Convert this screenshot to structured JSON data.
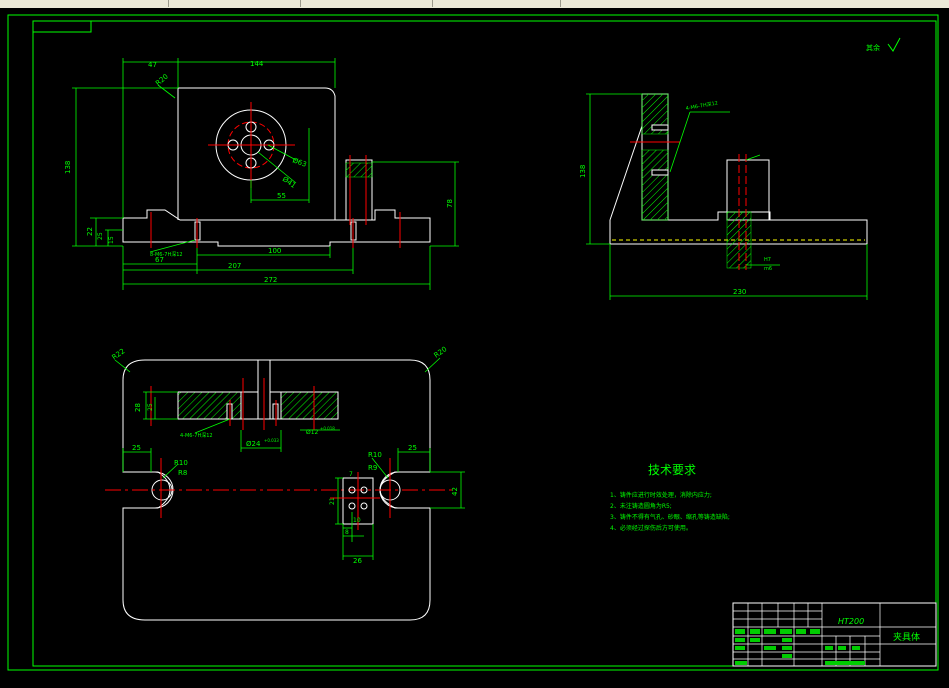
{
  "colors": {
    "background": "#000000",
    "outline": "#ffffff",
    "dimension": "#00ff00",
    "centerline": "#ff0000",
    "hatch": "#00ff00",
    "title_block_fill": "#00cc00",
    "hidden_line": "#ffff00"
  },
  "front_view": {
    "dims": {
      "d47": "47",
      "d144": "144",
      "r20": "R20",
      "d138": "138",
      "d78": "78",
      "d22": "22",
      "d25": "25",
      "d15": "15",
      "phi63": "Ø63",
      "phi41": "Ø41",
      "d55": "55",
      "d100": "100",
      "d67": "67",
      "d207": "207",
      "d272": "272",
      "screw_note": "8-M6-7H深12"
    }
  },
  "side_view": {
    "dims": {
      "d138": "138",
      "d230": "230",
      "screw_note": "4-M6-7H深12",
      "h7": "H7",
      "m6": "m6"
    }
  },
  "top_view": {
    "dims": {
      "r22": "R22",
      "r20": "R20",
      "d28": "28",
      "d25": "25",
      "screw_note": "4-M6-7H深12",
      "phi24": "Ø24",
      "phi24_tol": "+0.033",
      "phi12": "Ø12",
      "phi12_tol": "+0.018",
      "d25a": "25",
      "d25b": "25",
      "r10a": "R10",
      "r8": "R8",
      "r10b": "R10",
      "r9": "R9",
      "d42": "42",
      "d7": "7",
      "d21": "21",
      "d8": "8",
      "d10": "10",
      "d26": "26"
    }
  },
  "roughness": {
    "label": "其余"
  },
  "tech_requirements": {
    "title": "技术要求",
    "items": [
      "1、铸件应进行时效处理，消除内应力;",
      "2、未注铸造圆角为R5;",
      "3、铸件不得有气孔、砂眼、缩孔等铸造缺陷;",
      "4、必须经过探伤后方可使用。"
    ]
  },
  "title_block": {
    "material": "HT200",
    "part_name": "夹具体"
  }
}
